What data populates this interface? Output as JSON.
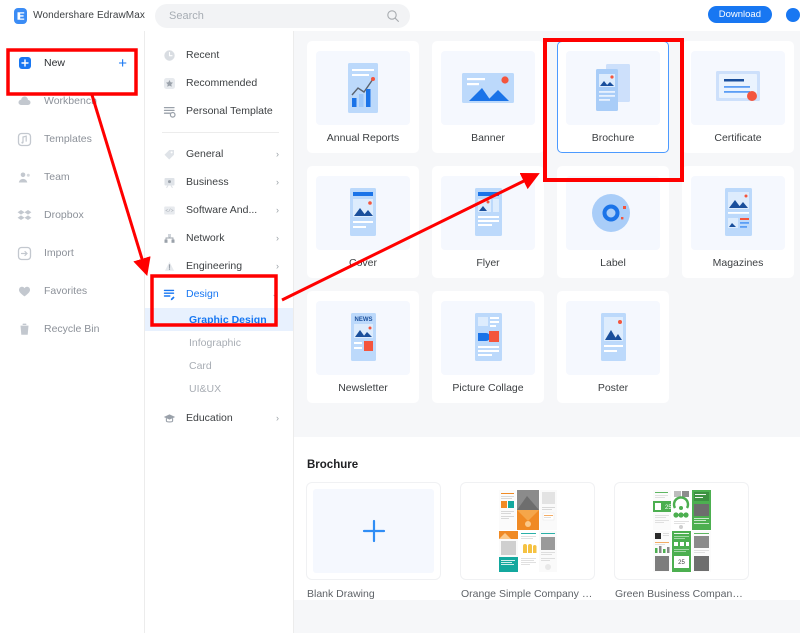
{
  "app": {
    "brand_name": "Wondershare EdrawMax",
    "logo_glyph": "Ǝ"
  },
  "topbar": {
    "search_placeholder": "Search",
    "search_value": "",
    "search_icon": "search-icon",
    "download_label": "Download"
  },
  "sidebar": {
    "items": [
      {
        "label": "New",
        "icon": "new-document-icon",
        "active": true,
        "plus": "+"
      },
      {
        "label": "Workbench",
        "icon": "cloud-icon",
        "active": false
      },
      {
        "label": "Templates",
        "icon": "templates-icon",
        "active": false
      },
      {
        "label": "Team",
        "icon": "team-icon",
        "active": false
      },
      {
        "label": "Dropbox",
        "icon": "dropbox-icon",
        "active": false
      },
      {
        "label": "Import",
        "icon": "import-icon",
        "active": false
      },
      {
        "label": "Favorites",
        "icon": "heart-icon",
        "active": false
      },
      {
        "label": "Recycle Bin",
        "icon": "trash-icon",
        "active": false
      }
    ]
  },
  "categories": {
    "top": [
      {
        "label": "Recent",
        "icon": "clock-icon"
      },
      {
        "label": "Recommended",
        "icon": "star-icon"
      },
      {
        "label": "Personal Template",
        "icon": "personal-template-icon"
      }
    ],
    "groups": [
      {
        "label": "General",
        "icon": "tag-icon",
        "arrow": "›",
        "selected": false
      },
      {
        "label": "Business",
        "icon": "business-icon",
        "arrow": "›",
        "selected": false
      },
      {
        "label": "Software And...",
        "icon": "software-icon",
        "arrow": "›",
        "selected": false
      },
      {
        "label": "Network",
        "icon": "network-icon",
        "arrow": "›",
        "selected": false
      },
      {
        "label": "Engineering",
        "icon": "engineering-icon",
        "arrow": "›",
        "selected": false
      },
      {
        "label": "Design",
        "icon": "design-icon",
        "arrow": "⌄",
        "selected": true
      }
    ],
    "design_subitems": [
      {
        "label": "Graphic Design",
        "active": true
      },
      {
        "label": "Infographic",
        "active": false
      },
      {
        "label": "Card",
        "active": false
      },
      {
        "label": "UI&UX",
        "active": false
      }
    ],
    "education": {
      "label": "Education",
      "icon": "education-icon",
      "arrow": "›"
    }
  },
  "templates": {
    "cards": [
      {
        "label": "Annual Reports",
        "thumb": "chart-report-thumb",
        "selected": false
      },
      {
        "label": "Banner",
        "thumb": "banner-thumb",
        "selected": false
      },
      {
        "label": "Brochure",
        "thumb": "brochure-thumb",
        "selected": true
      },
      {
        "label": "Certificate",
        "thumb": "certificate-thumb",
        "selected": false
      },
      {
        "label": "Cover",
        "thumb": "cover-thumb",
        "selected": false
      },
      {
        "label": "Flyer",
        "thumb": "flyer-thumb",
        "selected": false
      },
      {
        "label": "Label",
        "thumb": "label-thumb",
        "selected": false
      },
      {
        "label": "Magazines",
        "thumb": "magazines-thumb",
        "selected": false
      },
      {
        "label": "Newsletter",
        "thumb": "newsletter-thumb",
        "selected": false
      },
      {
        "label": "Picture Collage",
        "thumb": "picture-collage-thumb",
        "selected": false
      },
      {
        "label": "Poster",
        "thumb": "poster-thumb",
        "selected": false
      }
    ]
  },
  "brochure_section": {
    "title": "Brochure",
    "items": [
      {
        "label": "Blank Drawing",
        "kind": "blank",
        "plus": "+"
      },
      {
        "label": "Orange Simple Company P...",
        "kind": "orange"
      },
      {
        "label": "Green Business Company T...",
        "kind": "green"
      }
    ]
  },
  "annotations": {
    "accent_red": "#ff0000",
    "boxes": [
      "new-sidebar-item",
      "design-category",
      "brochure-card"
    ],
    "arrows": [
      "new-to-design-arrow",
      "design-to-brochure-arrow"
    ]
  }
}
